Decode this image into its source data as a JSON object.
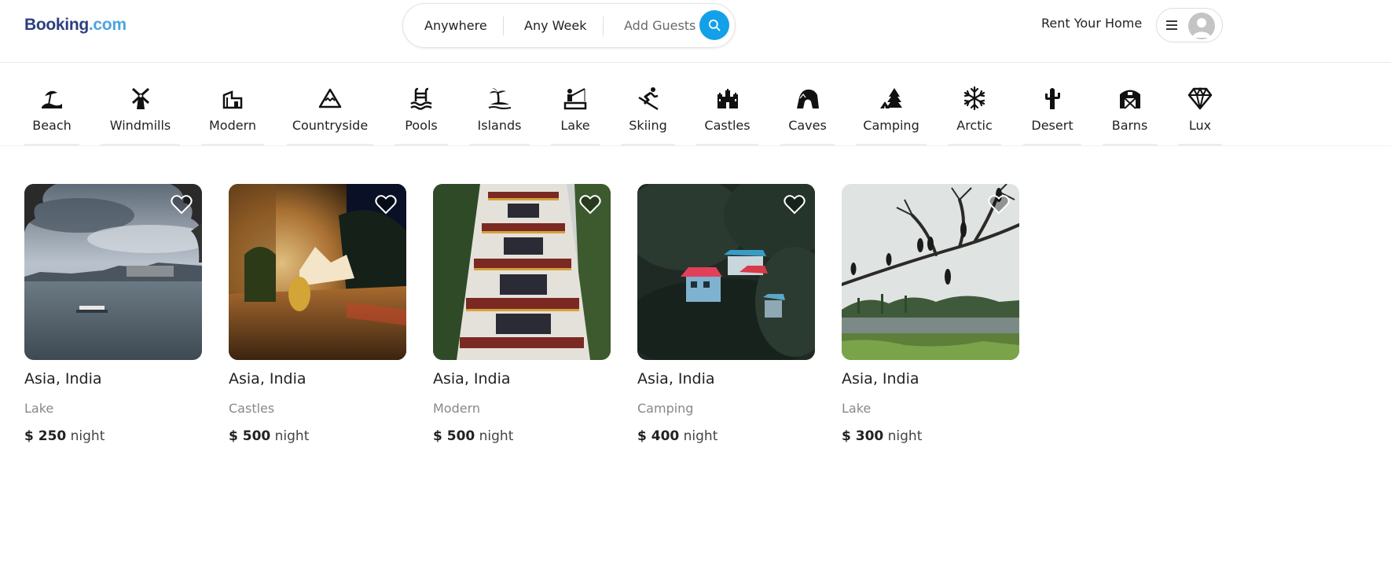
{
  "header": {
    "logo_part1": "Booking",
    "logo_part2": ".com",
    "search": {
      "where": "Anywhere",
      "when": "Any Week",
      "guests": "Add Guests",
      "icon": "search-icon"
    },
    "rent_link": "Rent Your Home",
    "menu_icon": "hamburger-icon",
    "avatar_icon": "avatar-placeholder"
  },
  "categories": [
    {
      "label": "Beach",
      "icon": "beach-umbrella-icon"
    },
    {
      "label": "Windmills",
      "icon": "windmill-icon"
    },
    {
      "label": "Modern",
      "icon": "modern-building-icon"
    },
    {
      "label": "Countryside",
      "icon": "mountain-icon"
    },
    {
      "label": "Pools",
      "icon": "pool-ladder-icon"
    },
    {
      "label": "Islands",
      "icon": "palm-island-icon"
    },
    {
      "label": "Lake",
      "icon": "fishing-icon"
    },
    {
      "label": "Skiing",
      "icon": "skier-icon"
    },
    {
      "label": "Castles",
      "icon": "castle-icon"
    },
    {
      "label": "Caves",
      "icon": "cave-icon"
    },
    {
      "label": "Camping",
      "icon": "tent-tree-icon"
    },
    {
      "label": "Arctic",
      "icon": "snowflake-icon"
    },
    {
      "label": "Desert",
      "icon": "cactus-icon"
    },
    {
      "label": "Barns",
      "icon": "barn-icon"
    },
    {
      "label": "Lux",
      "icon": "diamond-icon"
    }
  ],
  "listings": [
    {
      "location": "Asia, India",
      "category": "Lake",
      "price": "$ 250",
      "unit": "night"
    },
    {
      "location": "Asia, India",
      "category": "Castles",
      "price": "$ 500",
      "unit": "night"
    },
    {
      "location": "Asia, India",
      "category": "Modern",
      "price": "$ 500",
      "unit": "night"
    },
    {
      "location": "Asia, India",
      "category": "Camping",
      "price": "$ 400",
      "unit": "night"
    },
    {
      "location": "Asia, India",
      "category": "Lake",
      "price": "$ 300",
      "unit": "night"
    }
  ],
  "colors": {
    "accent": "#14a0e8",
    "logo_dark": "#2b3f7e",
    "logo_light": "#4aa3df",
    "muted_text": "#888888"
  }
}
